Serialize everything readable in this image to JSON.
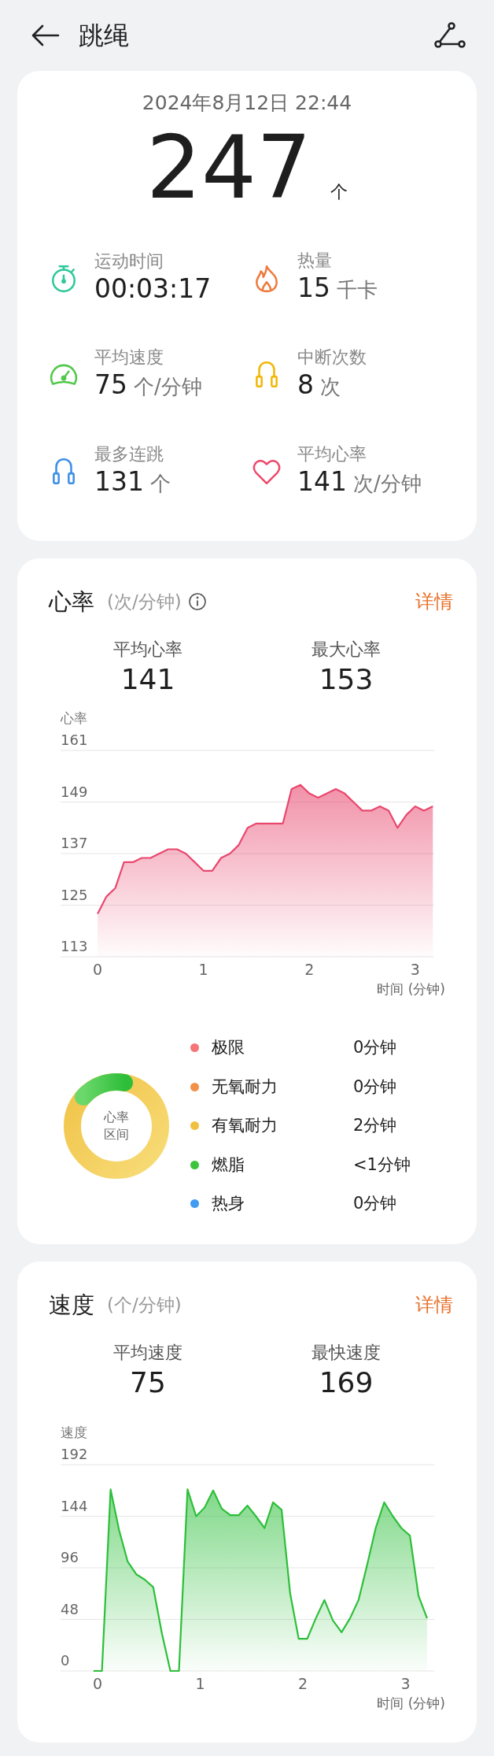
{
  "header": {
    "title": "跳绳"
  },
  "summary": {
    "datetime": "2024年8月12日 22:44",
    "count": "247",
    "count_unit": "个",
    "stats": [
      {
        "kind": "stopwatch",
        "color": "#2ec99a",
        "label": "运动时间",
        "value": "00:03:17"
      },
      {
        "kind": "flame",
        "color": "#ee7a3c",
        "label": "热量",
        "value": "15",
        "unit": "千卡"
      },
      {
        "kind": "gauge",
        "color": "#52c84a",
        "label": "平均速度",
        "value": "75",
        "unit": "个/分钟"
      },
      {
        "kind": "rope",
        "color": "#f2b705",
        "label": "中断次数",
        "value": "8",
        "unit": "次"
      },
      {
        "kind": "rope",
        "color": "#3d8fe6",
        "label": "最多连跳",
        "value": "131",
        "unit": "个"
      },
      {
        "kind": "heart",
        "color": "#ec4a6b",
        "label": "平均心率",
        "value": "141",
        "unit": "次/分钟"
      }
    ]
  },
  "heart_rate": {
    "title": "心率",
    "unit": "(次/分钟)",
    "info": true,
    "link": "详情",
    "metrics": [
      {
        "label": "平均心率",
        "value": "141"
      },
      {
        "label": "最大心率",
        "value": "153"
      }
    ],
    "chart_data": {
      "type": "area",
      "ylabel": "心率",
      "xlabel": "时间 (分钟)",
      "ylim": [
        113,
        161
      ],
      "yticks": [
        113,
        125,
        137,
        149,
        161
      ],
      "xlim": [
        -0.35,
        3.18
      ],
      "grid": true,
      "xticks": [
        0,
        1,
        2,
        3
      ],
      "x": [
        0,
        0.083,
        0.167,
        0.25,
        0.333,
        0.417,
        0.5,
        0.583,
        0.667,
        0.75,
        0.833,
        0.917,
        1,
        1.083,
        1.167,
        1.25,
        1.333,
        1.417,
        1.5,
        1.583,
        1.667,
        1.75,
        1.833,
        1.917,
        2,
        2.083,
        2.167,
        2.25,
        2.333,
        2.417,
        2.5,
        2.583,
        2.667,
        2.75,
        2.833,
        2.917,
        3,
        3.083,
        3.167
      ],
      "series": [
        {
          "color": "#e8486e",
          "values": [
            123,
            127,
            129,
            135,
            135,
            136,
            136,
            137,
            138,
            138,
            137,
            135,
            133,
            133,
            136,
            137,
            139,
            143,
            144,
            144,
            144,
            144,
            152,
            153,
            151,
            150,
            151,
            152,
            151,
            149,
            147,
            147,
            148,
            147,
            143,
            146,
            148,
            147,
            148
          ]
        }
      ]
    },
    "zones": {
      "center_label": "心率区间",
      "items": [
        {
          "name": "极限",
          "duration": "0分钟",
          "color": "#f47676"
        },
        {
          "name": "无氧耐力",
          "duration": "0分钟",
          "color": "#f0924a"
        },
        {
          "name": "有氧耐力",
          "duration": "2分钟",
          "color": "#f0c040"
        },
        {
          "name": "燃脂",
          "duration": "<1分钟",
          "color": "#3cc43c"
        },
        {
          "name": "热身",
          "duration": "0分钟",
          "color": "#3f9cf2"
        }
      ]
    }
  },
  "speed": {
    "title": "速度",
    "unit": "(个/分钟)",
    "link": "详情",
    "metrics": [
      {
        "label": "平均速度",
        "value": "75"
      },
      {
        "label": "最快速度",
        "value": "169"
      }
    ],
    "chart_data": {
      "type": "area",
      "ylabel": "速度",
      "xlabel": "时间 (分钟)",
      "ylim": [
        0,
        192
      ],
      "yticks": [
        0,
        48,
        96,
        144,
        192
      ],
      "xlim": [
        -0.36,
        3.28
      ],
      "grid": true,
      "xticks": [
        0,
        1,
        2,
        3
      ],
      "x": [
        -0.04,
        0.043,
        0.127,
        0.21,
        0.293,
        0.377,
        0.46,
        0.543,
        0.627,
        0.71,
        0.793,
        0.877,
        0.96,
        1.043,
        1.127,
        1.21,
        1.293,
        1.377,
        1.46,
        1.543,
        1.627,
        1.71,
        1.793,
        1.877,
        1.96,
        2.043,
        2.127,
        2.21,
        2.293,
        2.377,
        2.46,
        2.543,
        2.627,
        2.71,
        2.793,
        2.877,
        2.96,
        3.043,
        3.127,
        3.21
      ],
      "series": [
        {
          "color": "#2dbf3a",
          "values": [
            0,
            0,
            169,
            131,
            102,
            90,
            85,
            78,
            35,
            0,
            0,
            169,
            144,
            152,
            168,
            151,
            145,
            145,
            154,
            144,
            133,
            157,
            150,
            72,
            30,
            30,
            49,
            66,
            47,
            36,
            49,
            66,
            99,
            133,
            157,
            144,
            133,
            126,
            70,
            49
          ]
        }
      ]
    }
  }
}
